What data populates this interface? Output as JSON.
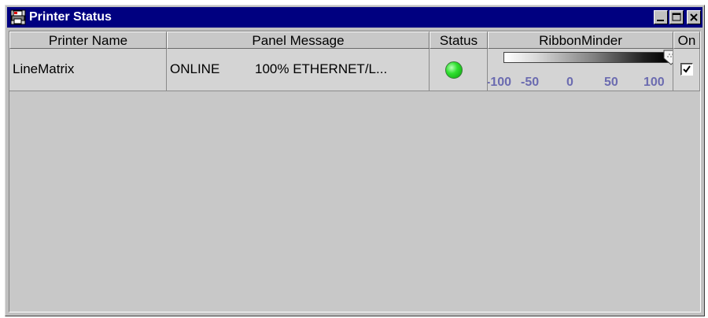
{
  "window": {
    "title": "Printer Status",
    "icons": [
      "printer-app-icon",
      "minimize-icon",
      "maximize-icon",
      "close-icon"
    ]
  },
  "table": {
    "columns": [
      "Printer Name",
      "Panel Message",
      "Status",
      "RibbonMinder",
      "On"
    ],
    "rows": [
      {
        "printer_name": "LineMatrix",
        "panel_message_state": "ONLINE",
        "panel_message_detail": "100% ETHERNET/L...",
        "status_color": "#30e030",
        "ribbon_scale": [
          "-100",
          "-50",
          "0",
          "50",
          "100"
        ],
        "ribbon_level": 100,
        "on": true
      }
    ]
  },
  "colors": {
    "titlebar": "#000080",
    "window": "#c0c0c0",
    "scale_text": "#6b6bb0"
  }
}
